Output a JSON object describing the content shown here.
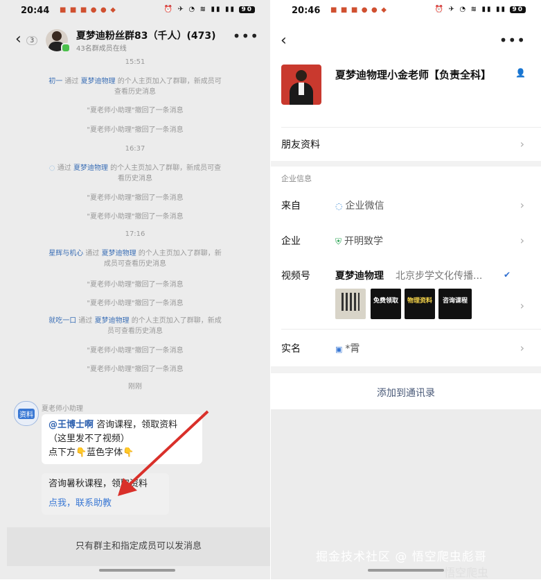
{
  "left": {
    "status": {
      "time": "20:44",
      "battery": "90"
    },
    "header": {
      "title": "夏梦迪粉丝群83（千人）(473)",
      "subtitle": "43名群成员在线",
      "badge": "3"
    },
    "messages": [
      {
        "type": "time",
        "text": "15:51"
      },
      {
        "type": "join",
        "name": "初一",
        "mid": " 通过 ",
        "by": "夏梦迪物理",
        "rest": " 的个人主页加入了群聊，新成员可查看历史消息"
      },
      {
        "type": "sys",
        "text": "\"夏老师小助理\"撤回了一条消息"
      },
      {
        "type": "sys",
        "text": "\"夏老师小助理\"撤回了一条消息"
      },
      {
        "type": "time",
        "text": "16:37"
      },
      {
        "type": "join",
        "name": "",
        "mid": " 通过 ",
        "by": "夏梦迪物理",
        "rest": " 的个人主页加入了群聊，新成员可查看历史消息"
      },
      {
        "type": "sys",
        "text": "\"夏老师小助理\"撤回了一条消息"
      },
      {
        "type": "sys",
        "text": "\"夏老师小助理\"撤回了一条消息"
      },
      {
        "type": "time",
        "text": "17:16"
      },
      {
        "type": "join",
        "name": "星辉与机心",
        "mid": " 通过 ",
        "by": "夏梦迪物理",
        "rest": " 的个人主页加入了群聊，新成员可查看历史消息"
      },
      {
        "type": "sys",
        "text": "\"夏老师小助理\"撤回了一条消息"
      },
      {
        "type": "sys",
        "text": "\"夏老师小助理\"撤回了一条消息"
      },
      {
        "type": "join",
        "name": "就吃一口",
        "mid": " 通过 ",
        "by": "夏梦迪物理",
        "rest": " 的个人主页加入了群聊，新成员可查看历史消息"
      },
      {
        "type": "sys",
        "text": "\"夏老师小助理\"撤回了一条消息"
      },
      {
        "type": "sys",
        "text": "\"夏老师小助理\"撤回了一条消息"
      },
      {
        "type": "time",
        "text": "刚刚"
      }
    ],
    "bot": {
      "name": "夏老师小助理",
      "avatar_text": "资料",
      "bubble1": {
        "mention": "@王博士啊",
        "line1": " 咨询课程，领取资料",
        "line2": "（这里发不了视频）",
        "line3": "点下方👇蓝色字体👇"
      },
      "bubble2": {
        "text": "咨询暑秋课程，领取资料",
        "link": "点我，联系助教"
      }
    },
    "footer": "只有群主和指定成员可以发消息"
  },
  "right": {
    "status": {
      "time": "20:46",
      "battery": "90"
    },
    "profile": {
      "name": "夏梦迪物理小金老师【负责全科】"
    },
    "friend_info": "朋友资料",
    "section": "企业信息",
    "rows": {
      "from_label": "来自",
      "from_value": "企业微信",
      "company_label": "企业",
      "company_value": "开明致学",
      "channel_label": "视频号",
      "channel_name": "夏梦迪物理",
      "channel_org": "北京步学文化传播...",
      "realname_label": "实名",
      "realname_value": "*霄"
    },
    "thumbs": [
      "免费领取",
      "物理资料",
      "咨询课程"
    ],
    "add_contact": "添加到通讯录"
  },
  "watermark": "掘金技术社区 @ 悟空爬虫彪哥",
  "watermark2": "悟空爬虫"
}
